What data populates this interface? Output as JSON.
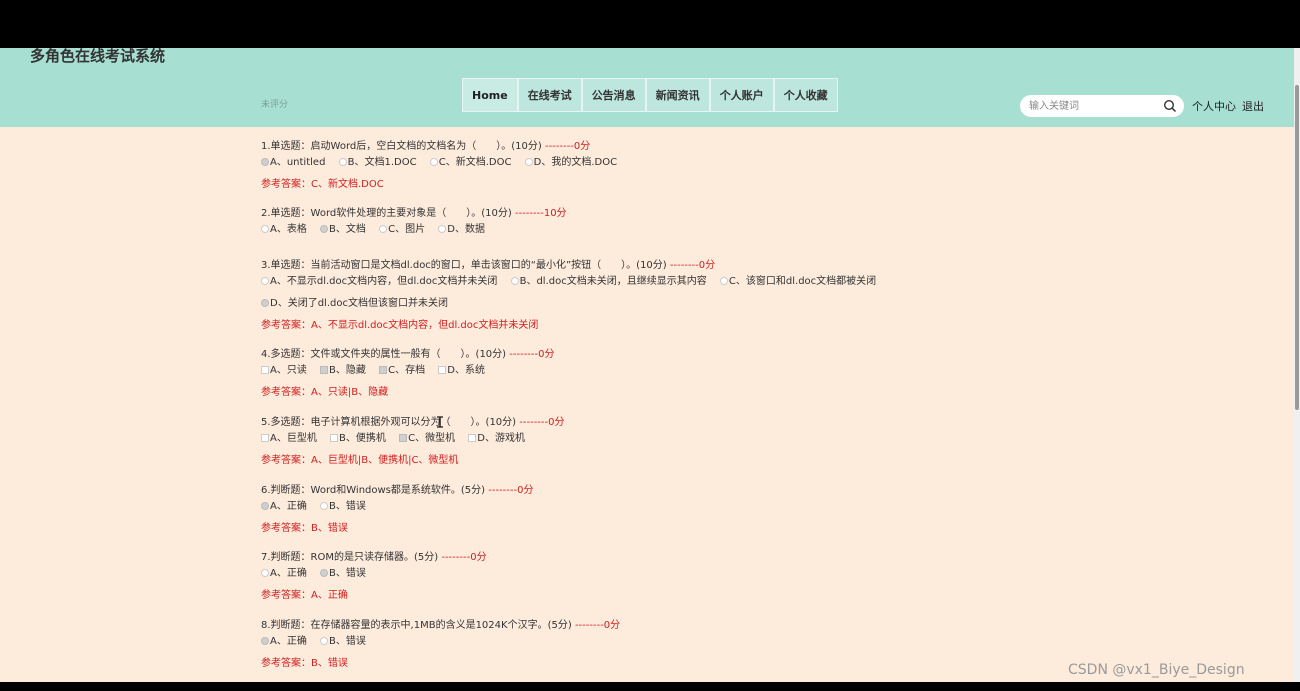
{
  "header": {
    "site_title": "多角色在线考试系统",
    "search_placeholder": "输入关键词",
    "personal_center": "个人中心",
    "logout": "退出"
  },
  "nav": [
    "Home",
    "在线考试",
    "公告消息",
    "新闻资讯",
    "个人账户",
    "个人收藏"
  ],
  "eval_status": "未评分",
  "questions": [
    {
      "title": "1.单选题：启动Word后，空白文档的文档名为（　　）。(10分)",
      "score": "--------0分",
      "options": [
        "A、untitled",
        "B、文档1.DOC",
        "C、新文档.DOC",
        "D、我的文档.DOC"
      ],
      "answer": "参考答案：C、新文档.DOC"
    },
    {
      "title": "2.单选题：Word软件处理的主要对象是（　　）。(10分)",
      "score": "--------10分",
      "options": [
        "A、表格",
        "B、文档",
        "C、图片",
        "D、数据"
      ],
      "answer": ""
    },
    {
      "title": "3.单选题：当前活动窗口是文档dl.doc的窗口，单击该窗口的“最小化”按钮（　　）。(10分)",
      "score": "--------0分",
      "options": [
        "A、不显示dl.doc文档内容，但dl.doc文档并未关闭",
        "B、dl.doc文档未关闭，且继续显示其内容",
        "C、该窗口和dl.doc文档都被关闭"
      ],
      "options2": [
        "D、关闭了dl.doc文档但该窗口并未关闭"
      ],
      "answer": "参考答案：A、不显示dl.doc文档内容，但dl.doc文档并未关闭"
    },
    {
      "title": "4.多选题：文件或文件夹的属性一般有（　　）。(10分)",
      "score": "--------0分",
      "options": [
        "A、只读",
        "B、隐藏",
        "C、存档",
        "D、系统"
      ],
      "answer": "参考答案：A、只读|B、隐藏"
    },
    {
      "title": "5.多选题：电子计算机根据外观可以分为（　　）。(10分)",
      "score": "--------0分",
      "options": [
        "A、巨型机",
        "B、便携机",
        "C、微型机",
        "D、游戏机"
      ],
      "answer": "参考答案：A、巨型机|B、便携机|C、微型机"
    },
    {
      "title": "6.判断题：Word和Windows都是系统软件。(5分)",
      "score": "--------0分",
      "options": [
        "A、正确",
        "B、错误"
      ],
      "answer": "参考答案：B、错误"
    },
    {
      "title": "7.判断题：ROM的是只读存储器。(5分)",
      "score": "--------0分",
      "options": [
        "A、正确",
        "B、错误"
      ],
      "answer": "参考答案：A、正确"
    },
    {
      "title": "8.判断题：在存储器容量的表示中,1MB的含义是1024K个汉字。(5分)",
      "score": "--------0分",
      "options": [
        "A、正确",
        "B、错误"
      ],
      "answer": "参考答案：B、错误"
    }
  ],
  "watermark": "CSDN @vx1_Biye_Design"
}
